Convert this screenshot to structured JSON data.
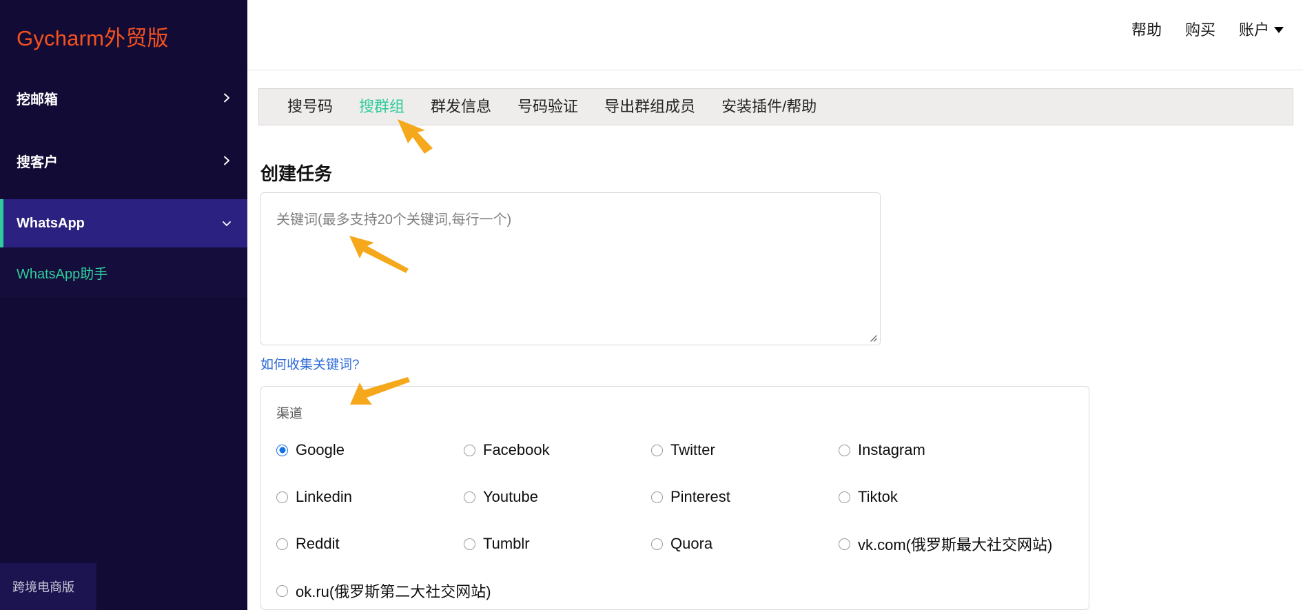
{
  "brand": {
    "name": "Gycharm外贸版"
  },
  "sidebar": {
    "items": [
      {
        "label": "挖邮箱",
        "icon": "chevron-right-icon",
        "active": false
      },
      {
        "label": "搜客户",
        "icon": "chevron-right-icon",
        "active": false
      },
      {
        "label": "WhatsApp",
        "icon": "chevron-down-icon",
        "active": true
      }
    ],
    "subitems": [
      {
        "label": "WhatsApp助手",
        "active": true
      }
    ],
    "footer_badge": "跨境电商版",
    "colors": {
      "background": "#120b35",
      "active_background": "#2a2180",
      "accent": "#2ecc9b",
      "brand": "#f4511e"
    }
  },
  "topbar": {
    "links": [
      {
        "label": "帮助",
        "icon": null
      },
      {
        "label": "购买",
        "icon": null
      },
      {
        "label": "账户",
        "icon": "caret-down-icon"
      }
    ]
  },
  "tabs": [
    {
      "label": "搜号码",
      "active": false
    },
    {
      "label": "搜群组",
      "active": true
    },
    {
      "label": "群发信息",
      "active": false
    },
    {
      "label": "号码验证",
      "active": false
    },
    {
      "label": "导出群组成员",
      "active": false
    },
    {
      "label": "安装插件/帮助",
      "active": false
    }
  ],
  "main": {
    "page_title": "创建任务",
    "keyword_input": {
      "value": "",
      "placeholder": "关键词(最多支持20个关键词,每行一个)"
    },
    "help_link": "如何收集关键词?",
    "channel": {
      "legend": "渠道",
      "selected": "Google",
      "rows": [
        [
          {
            "label": "Google",
            "checked": true
          },
          {
            "label": "Facebook",
            "checked": false
          },
          {
            "label": "Twitter",
            "checked": false
          },
          {
            "label": "Instagram",
            "checked": false
          }
        ],
        [
          {
            "label": "Linkedin",
            "checked": false
          },
          {
            "label": "Youtube",
            "checked": false
          },
          {
            "label": "Pinterest",
            "checked": false
          },
          {
            "label": "Tiktok",
            "checked": false
          }
        ],
        [
          {
            "label": "Reddit",
            "checked": false
          },
          {
            "label": "Tumblr",
            "checked": false
          },
          {
            "label": "Quora",
            "checked": false
          },
          {
            "label": "vk.com(俄罗斯最大社交网站)",
            "checked": false
          }
        ],
        [
          {
            "label": "ok.ru(俄罗斯第二大社交网站)",
            "checked": false
          }
        ]
      ]
    }
  },
  "annotations": {
    "arrow_color": "#f5a81c",
    "arrows": [
      {
        "name": "arrow-pointing-to-tab-search-group"
      },
      {
        "name": "arrow-pointing-to-keyword-textarea"
      },
      {
        "name": "arrow-pointing-to-channel-fieldset"
      }
    ]
  }
}
